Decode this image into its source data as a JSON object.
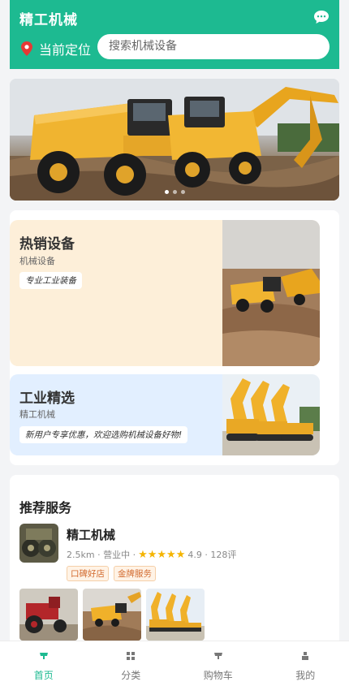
{
  "header": {
    "title": "精工机械",
    "location_label": "当前定位",
    "search_placeholder": "搜索机械设备",
    "icons": {
      "chat": "chat-bubble-icon",
      "location": "map-pin-icon"
    }
  },
  "banner": {
    "image": "articulated-dump-truck-excavator-photo",
    "slide_count": 3,
    "active_slide": 1
  },
  "promos": [
    {
      "title": "热销设备",
      "subtitle": "机械设备",
      "tag": "专业工业装备",
      "bg": "#fdefd9",
      "image": "dump-trucks-photo"
    },
    {
      "title": "工业精选",
      "subtitle": "精工机械",
      "tag": "新用户专享优惠，欢迎选购机械设备好物!",
      "bg": "#e2efff",
      "image": "excavators-row-photo"
    }
  ],
  "recommend": {
    "title": "推荐服务",
    "shop": {
      "name": "精工机械",
      "distance": "2.5km",
      "status": "营业中",
      "rating_stars": 5,
      "rating": "4.9",
      "reviews": "128评",
      "tags": [
        "口碑好店",
        "金牌服务"
      ]
    },
    "thumbnails": [
      "red-tractor-photo",
      "dump-truck-photo",
      "excavators-photo"
    ]
  },
  "tabbar": {
    "active": 0,
    "items": [
      {
        "label": "首页",
        "icon": "home-icon"
      },
      {
        "label": "分类",
        "icon": "grid-icon"
      },
      {
        "label": "购物车",
        "icon": "cart-icon"
      },
      {
        "label": "我的",
        "icon": "user-icon"
      }
    ]
  },
  "colors": {
    "brand": "#1dba91",
    "star": "#f4b400",
    "tag_text": "#d26a2e"
  }
}
